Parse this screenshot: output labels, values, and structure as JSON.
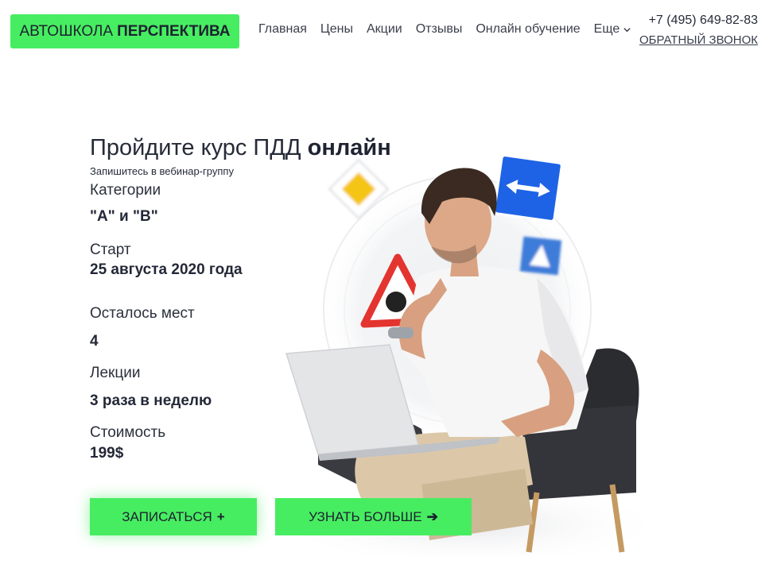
{
  "header": {
    "logo_light": "АВТОШКОЛА",
    "logo_bold": "ПЕРСПЕКТИВА",
    "nav": [
      "Главная",
      "Цены",
      "Акции",
      "Отзывы",
      "Онлайн обучение"
    ],
    "more_label": "Еще",
    "phone": "+7 (495) 649-82-83",
    "callback": "ОБРАТНЫЙ ЗВОНОК"
  },
  "hero": {
    "title_regular": "Пройдите курс ПДД ",
    "title_bold": "онлайн",
    "subtitle": "Запишитесь в вебинар-группу",
    "categories_label": "Категории",
    "categories_value": "\"А\" и \"В\"",
    "start_label": "Старт",
    "start_value": "25 августа 2020 года",
    "seats_label": "Осталось мест",
    "seats_value": "4",
    "lectures_label": "Лекции",
    "lectures_value": "3 раза в неделю",
    "price_label": "Стоимость",
    "price_value": "199$"
  },
  "buttons": {
    "signup": "ЗАПИСАТЬСЯ",
    "signup_glyph": "+",
    "more": "УЗНАТЬ БОЛЬШЕ",
    "more_glyph": "➔"
  },
  "colors": {
    "accent": "#47ed61",
    "text": "#1f2433"
  },
  "icons": {
    "chevron": "chevron-down-icon",
    "priority_sign": "priority-road-sign-icon",
    "two_way_sign": "two-way-arrow-sign-icon",
    "pedestrian_sign": "pedestrian-crossing-sign-icon",
    "warning_sign": "warning-triangle-sign-icon"
  }
}
